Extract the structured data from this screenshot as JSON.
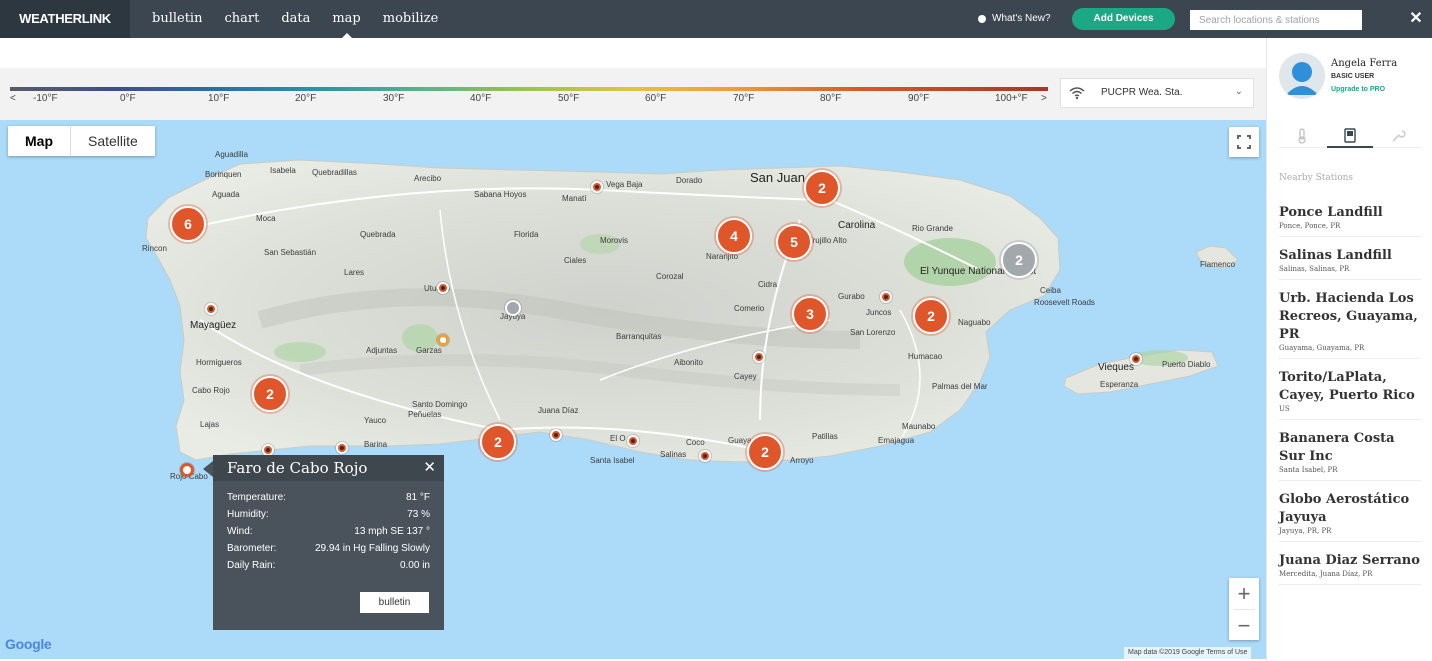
{
  "app": {
    "brand": "WEATHERLINK"
  },
  "nav": [
    {
      "label": "bulletin",
      "active": false
    },
    {
      "label": "chart",
      "active": false
    },
    {
      "label": "data",
      "active": false
    },
    {
      "label": "map",
      "active": true
    },
    {
      "label": "mobilize",
      "active": false
    }
  ],
  "header": {
    "whats_new": "What's New?",
    "add_devices": "Add Devices",
    "search_placeholder": "Search locations & stations",
    "close": "✕"
  },
  "scale": {
    "left_arrow": "<",
    "right_arrow": ">",
    "labels": [
      "-10°F",
      "0°F",
      "10°F",
      "20°F",
      "30°F",
      "40°F",
      "50°F",
      "60°F",
      "70°F",
      "80°F",
      "90°F",
      "100+°F"
    ]
  },
  "station_select": {
    "value": "PUCPR Wea. Sta."
  },
  "map": {
    "type_options": [
      "Map",
      "Satellite"
    ],
    "active_type": "Map",
    "attribution": "Map data ©2019 Google   Terms of Use",
    "google": "Google",
    "zoom_in": "+",
    "zoom_out": "−",
    "places": {
      "san_juan": "San Juan",
      "carolina": "Carolina",
      "vega_baja": "Vega Baja",
      "manati": "Manatí",
      "dorado": "Dorado",
      "arecibo": "Arecibo",
      "quebradillas": "Quebradillas",
      "isabela": "Isabela",
      "aguadilla": "Aguadilla",
      "aguada": "Aguada",
      "rincon": "Rincon",
      "mayaguez": "Mayagüez",
      "hormigueros": "Hormigueros",
      "cabo_rojo": "Cabo Rojo",
      "lajas": "Lajas",
      "yauco": "Yauco",
      "barina": "Barina",
      "santo_domingo": "Santo Domingo",
      "juana_diaz": "Juana Díaz",
      "santa_isabel": "Santa Isabel",
      "salinas": "Salinas",
      "coco": "Coco",
      "arroyo": "Arroyo",
      "patillas": "Patillas",
      "emajagua": "Emajagua",
      "guayama": "Guayama",
      "cayey": "Cayey",
      "aibonito": "Aibonito",
      "barranquitas": "Barranquitas",
      "jayuya": "Jayuya",
      "garzas": "Garzas",
      "adjuntas": "Adjuntas",
      "utuado": "Utuado",
      "lares": "Lares",
      "san_sebastian": "San Sebastián",
      "moca": "Moca",
      "quebrada": "Quebrada",
      "florida": "Florida",
      "ciales": "Ciales",
      "morovis": "Morovis",
      "corozal": "Corozal",
      "naranjito": "Naranjito",
      "comerio": "Comerio",
      "trujillo_alto": "Trujillo Alto",
      "gurabo": "Gurabo",
      "juncos": "Juncos",
      "san_lorenzo": "San Lorenzo",
      "humacao": "Humacao",
      "naguabo": "Naguabo",
      "ceiba": "Ceiba",
      "roosevelt_roads": "Roosevelt Roads",
      "yunque": "El Yunque National Forest",
      "rio_grande": "Rio Grande",
      "palmas": "Palmas del Mar",
      "maunabo": "Maunabo",
      "vieques": "Vieques",
      "esperanza": "Esperanza",
      "puerto_diablo": "Puerto Diablo",
      "flamenco": "Flamenco",
      "rojo_cabo": "Rojo Cabo",
      "borinquen": "Borinquen",
      "sabana_hoyos": "Sabana Hoyos",
      "penuelas": "Peñuelas",
      "el_o": "El O",
      "cidra": "Cidra"
    },
    "clusters": [
      {
        "id": "cluster-sanjuan",
        "count": "2"
      },
      {
        "id": "cluster-west",
        "count": "6"
      },
      {
        "id": "cluster-bayamon",
        "count": "4"
      },
      {
        "id": "cluster-guaynabo",
        "count": "5"
      },
      {
        "id": "cluster-ceiba",
        "count": "2"
      },
      {
        "id": "cluster-caguas",
        "count": "3"
      },
      {
        "id": "cluster-humacao",
        "count": "2"
      },
      {
        "id": "cluster-caborojo",
        "count": "2"
      },
      {
        "id": "cluster-ponce",
        "count": "2"
      },
      {
        "id": "cluster-guayama",
        "count": "2"
      }
    ]
  },
  "popup": {
    "title": "Faro de Cabo Rojo",
    "close": "✕",
    "rows": [
      {
        "label": "Temperature:",
        "value": "81 °F"
      },
      {
        "label": "Humidity:",
        "value": "73 %"
      },
      {
        "label": "Wind:",
        "value": "13 mph SE 137 °"
      },
      {
        "label": "Barometer:",
        "value": "29.94 in Hg Falling Slowly"
      },
      {
        "label": "Daily Rain:",
        "value": "0.00 in"
      }
    ],
    "button": "bulletin"
  },
  "user": {
    "name": "Angela Ferra",
    "role": "BASIC USER",
    "upgrade": "Upgrade to PRO"
  },
  "panel": {
    "nearby_title": "Nearby Stations",
    "stations": [
      {
        "name": "Ponce Landfill",
        "location": "Ponce, Ponce, PR"
      },
      {
        "name": "Salinas Landfill",
        "location": "Salinas, Salinas, PR"
      },
      {
        "name": "Urb. Hacienda Los Recreos, Guayama, PR",
        "location": "Guayama, Guayama, PR"
      },
      {
        "name": "Torito/LaPlata, Cayey, Puerto Rico",
        "location": "US"
      },
      {
        "name": "Bananera Costa Sur Inc",
        "location": "Santa Isabel, PR"
      },
      {
        "name": "Globo Aerostático Jayuya",
        "location": "Jayuya, PR, PR"
      },
      {
        "name": "Juana Diaz Serrano",
        "location": "Mercedita, Juana Díaz, PR"
      }
    ]
  },
  "colors": {
    "nav_bg": "#3b4650",
    "accent_green": "#1ba885",
    "cluster_orange": "#e0562b",
    "cluster_gray": "#a3a8ad",
    "water": "#acdaf9",
    "popup_bg": "#4a535b"
  }
}
